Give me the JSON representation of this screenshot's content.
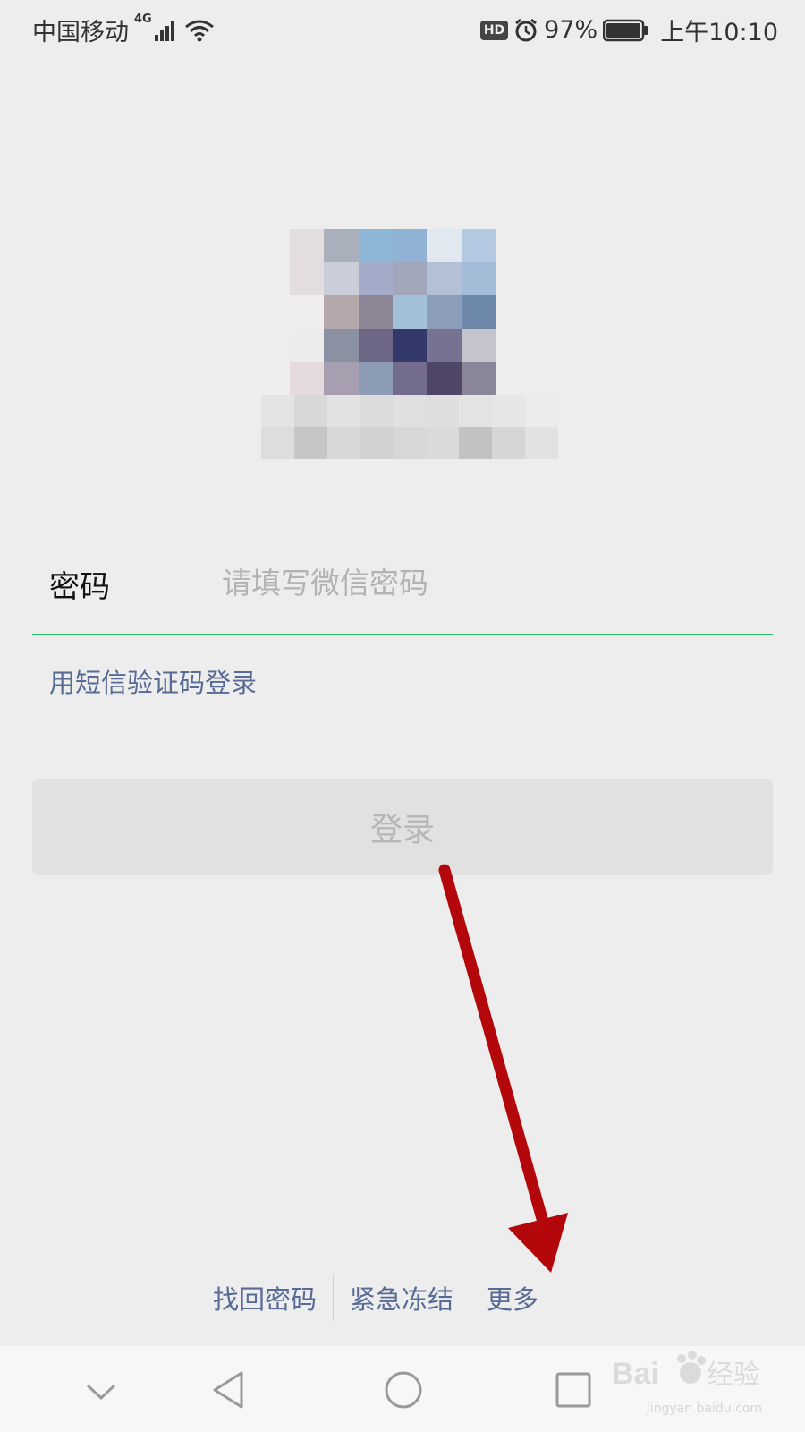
{
  "status_bar": {
    "carrier": "中国移动",
    "network": "4G",
    "hd": "HD",
    "battery": "97%",
    "time": "上午10:10"
  },
  "login": {
    "password_label": "密码",
    "password_placeholder": "请填写微信密码",
    "sms_login_link": "用短信验证码登录",
    "login_button": "登录"
  },
  "bottom_links": {
    "recover_password": "找回密码",
    "emergency_freeze": "紧急冻结",
    "more": "更多"
  },
  "watermark": {
    "text": "jingyan.baidu.com"
  }
}
